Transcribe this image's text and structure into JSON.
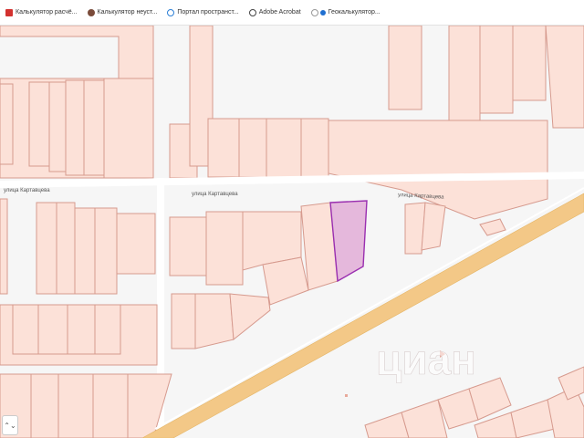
{
  "bookmarks": [
    {
      "label": "Калькулятор расчё...",
      "icon": "red-document-icon",
      "color": "#d3322f"
    },
    {
      "label": "Калькулятор неуст...",
      "icon": "coin-icon",
      "color": "#7a4b3a"
    },
    {
      "label": "Портал пространст...",
      "icon": "globe-icon",
      "color": "#2c7fd6"
    },
    {
      "label": "Adobe Acrobat",
      "icon": "globe-icon",
      "color": "#444444"
    },
    {
      "label": "Геокалькулятор...",
      "icon": "geo-icon",
      "color": "#1f6fd0"
    }
  ],
  "map": {
    "street_labels": [
      "улица Картавцева",
      "улица Картавцева",
      "улица Картавцева"
    ],
    "watermark": "циан",
    "colors": {
      "parcel_fill": "#fce1d8",
      "parcel_stroke": "#d69a8e",
      "selected_fill": "#e5b8dc",
      "selected_stroke": "#9a2fb0",
      "road": "#f3c887"
    }
  },
  "controls": {
    "scroll_arrows": "⌃⌄"
  }
}
